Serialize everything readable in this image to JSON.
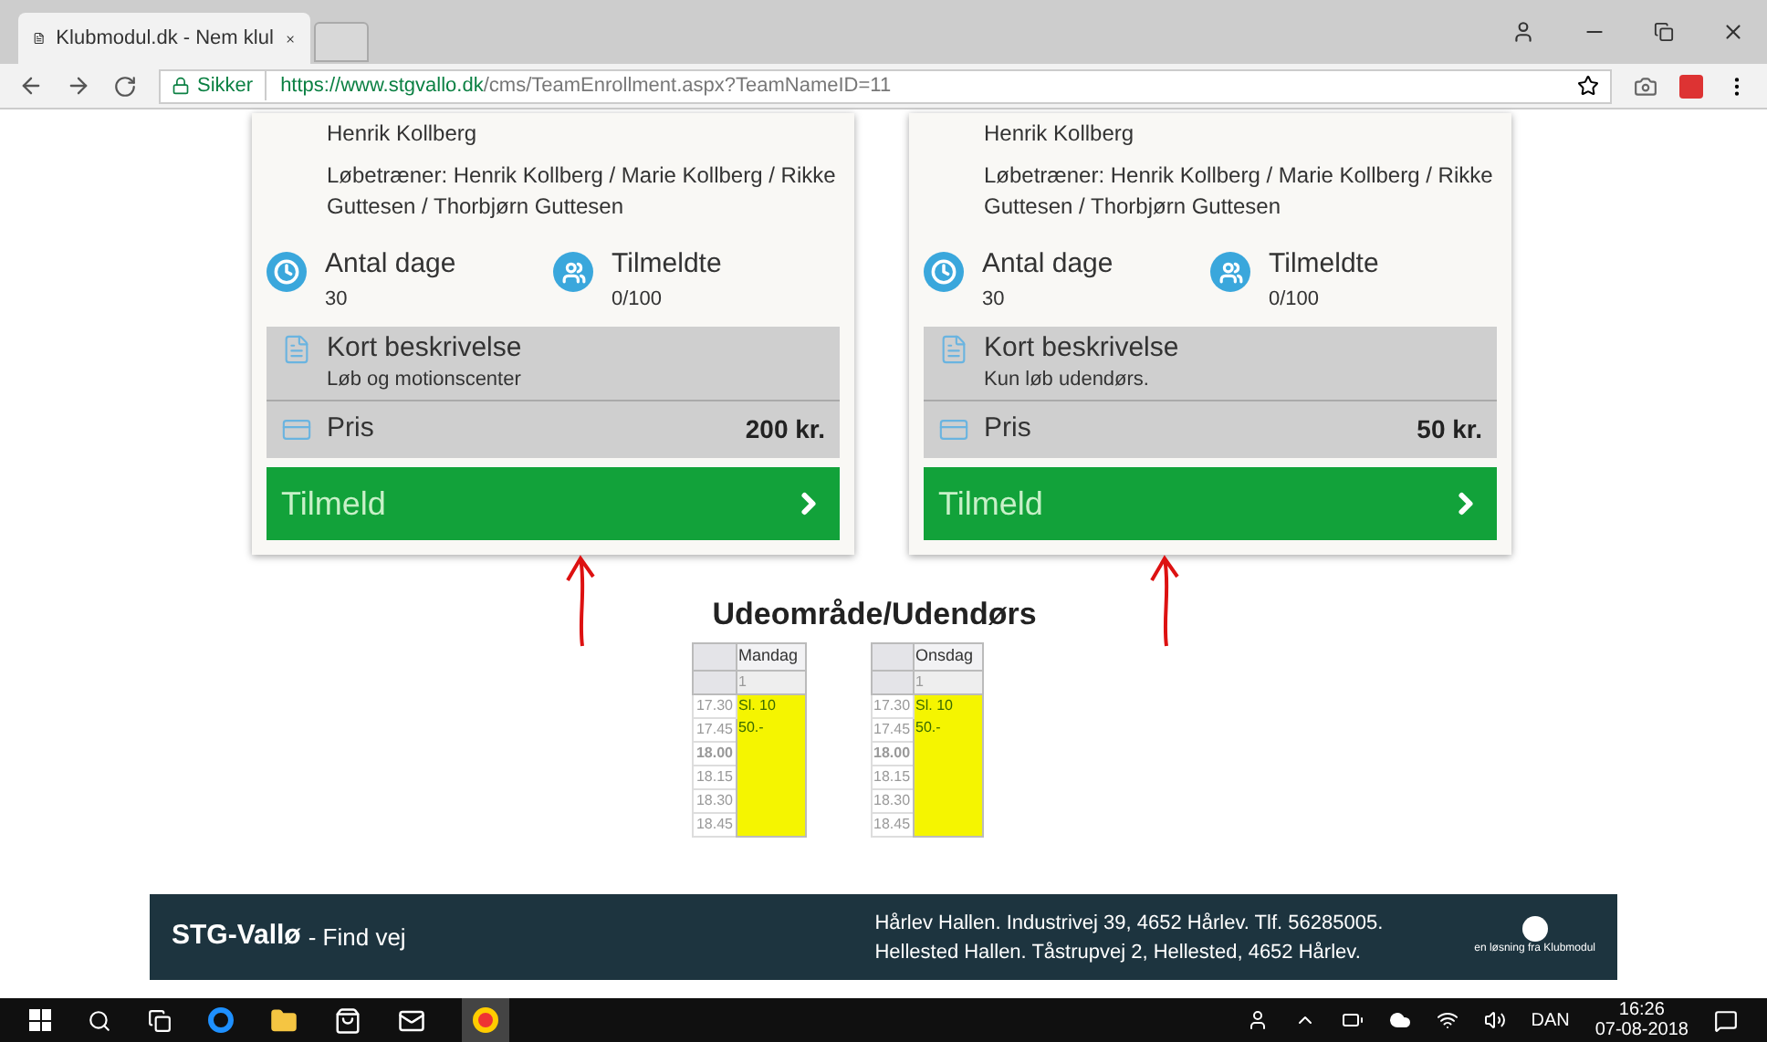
{
  "browser": {
    "tab_title": "Klubmodul.dk - Nem klul",
    "secure_label": "Sikker",
    "url_host": "https://www.stgvallo.dk",
    "url_path": "/cms/TeamEnrollment.aspx?TeamNameID=11"
  },
  "cards": [
    {
      "instructor": "Henrik Kollberg",
      "trainers": "Løbetræner: Henrik Kollberg / Marie Kollberg / Rikke Guttesen / Thorbjørn Guttesen",
      "days_label": "Antal dage",
      "days": "30",
      "enrolled_label": "Tilmeldte",
      "enrolled": "0/100",
      "desc_label": "Kort beskrivelse",
      "desc": "Løb og motionscenter",
      "price_label": "Pris",
      "price": "200 kr.",
      "button": "Tilmeld"
    },
    {
      "instructor": "Henrik Kollberg",
      "trainers": "Løbetræner: Henrik Kollberg / Marie Kollberg / Rikke Guttesen / Thorbjørn Guttesen",
      "days_label": "Antal dage",
      "days": "30",
      "enrolled_label": "Tilmeldte",
      "enrolled": "0/100",
      "desc_label": "Kort beskrivelse",
      "desc": "Kun løb udendørs.",
      "price_label": "Pris",
      "price": "50 kr.",
      "button": "Tilmeld"
    }
  ],
  "schedule_title": "Udeområde/Udendørs",
  "schedules": [
    {
      "day": "Mandag",
      "column_number": "1",
      "times": [
        "17.30",
        "17.45",
        "18.00",
        "18.15",
        "18.30",
        "18.45"
      ],
      "entries": [
        "Sl. 10",
        "50.-"
      ]
    },
    {
      "day": "Onsdag",
      "column_number": "1",
      "times": [
        "17.30",
        "17.45",
        "18.00",
        "18.15",
        "18.30",
        "18.45"
      ],
      "entries": [
        "Sl. 10",
        "50.-"
      ]
    }
  ],
  "footer": {
    "brand": "STG-Vallø",
    "link": "- Find vej",
    "address_lines": [
      "Hårlev Hallen. Industrivej 39, 4652 Hårlev. Tlf. 56285005.",
      "Hellested Hallen. Tåstrupvej 2, Hellested, 4652 Hårlev."
    ],
    "credit": "en løsning fra Klubmodul"
  },
  "taskbar": {
    "language": "DAN",
    "time": "16:26",
    "date": "07-08-2018"
  }
}
